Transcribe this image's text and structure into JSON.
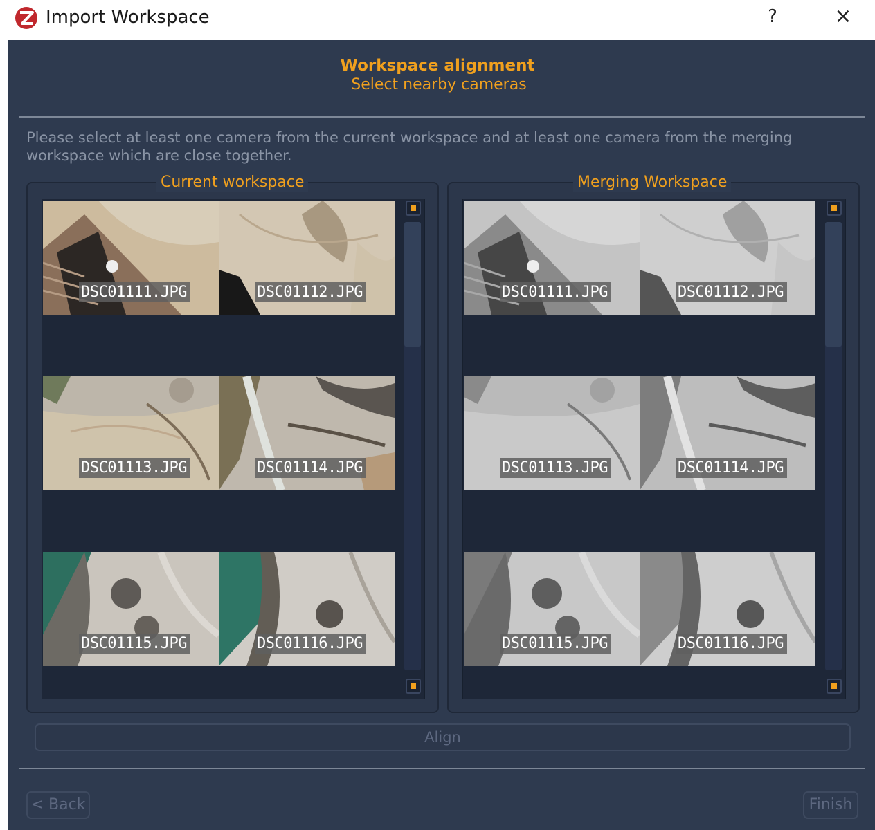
{
  "window": {
    "title": "Import Workspace",
    "help_label": "?",
    "close_label": "×"
  },
  "header": {
    "title": "Workspace alignment",
    "subtitle": "Select nearby cameras"
  },
  "instructions": "Please select at least one camera from the current workspace and at least one camera from the merging workspace which are close together.",
  "current_workspace": {
    "title": "Current workspace",
    "cameras": [
      "DSC01111.JPG",
      "DSC01112.JPG",
      "DSC01113.JPG",
      "DSC01114.JPG",
      "DSC01115.JPG",
      "DSC01116.JPG"
    ]
  },
  "merging_workspace": {
    "title": "Merging Workspace",
    "cameras": [
      "DSC01111.JPG",
      "DSC01112.JPG",
      "DSC01113.JPG",
      "DSC01114.JPG",
      "DSC01115.JPG",
      "DSC01116.JPG"
    ]
  },
  "buttons": {
    "align": "Align",
    "back": "< Back",
    "finish": "Finish"
  },
  "colors": {
    "background": "#2e3a4f",
    "accent": "#f0a01e",
    "muted_text": "#8a94a5",
    "disabled_text": "#5d6880"
  }
}
